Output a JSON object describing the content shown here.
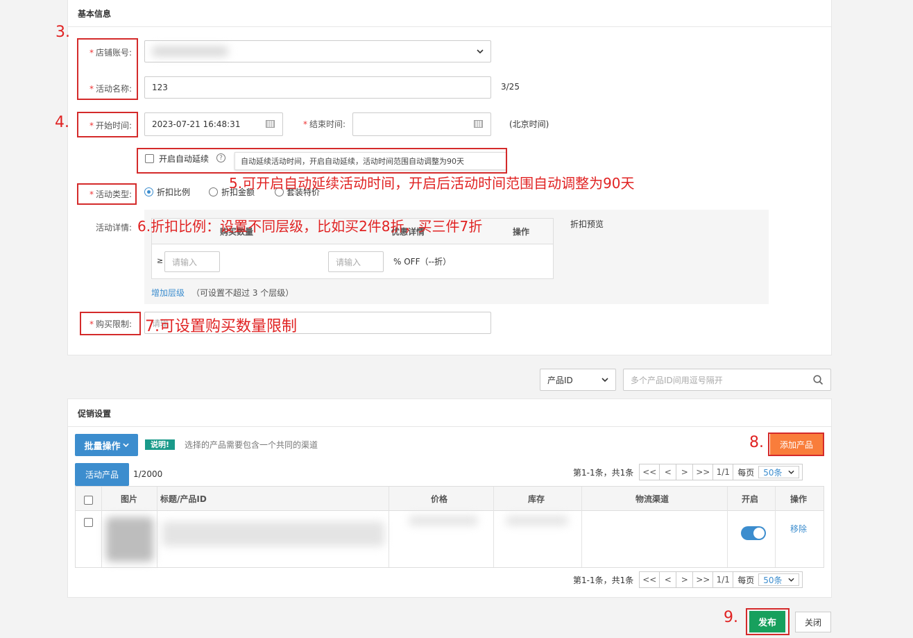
{
  "basic": {
    "title": "基本信息",
    "store_label": "店铺账号:",
    "name_label": "活动名称:",
    "name_value": "123",
    "name_count": "3/25",
    "start_label": "开始时间:",
    "start_value": "2023-07-21 16:48:31",
    "end_label": "结束时间:",
    "timezone": "(北京时间)",
    "auto_extend_label": "开启自动延续",
    "tooltip": "自动延续活动时间，开启自动延续，活动时间范围自动调整为90天",
    "type_label": "活动类型:",
    "type_options": [
      "折扣比例",
      "折扣金额",
      "套装特价"
    ],
    "detail_label": "活动详情:",
    "preview_label": "折扣预览",
    "tier_headers": [
      "购买数量",
      "优惠详情",
      "操作"
    ],
    "qty_prefix": "≥",
    "qty_placeholder": "请输入",
    "discount_placeholder": "请输入",
    "discount_suffix": "% OFF（--折）",
    "add_tier": "增加层级",
    "add_tier_note": "（可设置不超过 3 个层级）",
    "limit_label": "购买限制:",
    "limit_placeholder": "请输"
  },
  "search": {
    "select_value": "产品ID",
    "placeholder": "多个产品ID间用逗号隔开"
  },
  "promo": {
    "title": "促销设置",
    "batch_label": "批量操作",
    "note_badge": "说明!",
    "note_text": "选择的产品需要包含一个共同的渠道",
    "add_product": "添加产品",
    "tab_active": "活动产品",
    "count": "1/2000",
    "pager_text": "第1-1条，共1条",
    "pager_buttons": [
      "<<",
      "<",
      ">",
      ">>"
    ],
    "page_info": "1/1",
    "per_page_label": "每页",
    "per_page_value": "50条",
    "columns": [
      "图片",
      "标题/产品ID",
      "价格",
      "库存",
      "物流渠道",
      "开启",
      "操作"
    ],
    "row_action": "移除",
    "publish": "发布",
    "close": "关闭"
  },
  "annotations": {
    "a3": "3.",
    "a4": "4.",
    "a5": "5.可开启自动延续活动时间，开启后活动时间范围自动调整为90天",
    "a6": "6.折扣比例：设置不同层级，比如买2件8折，买三件7折",
    "a7": "7.可设置购买数量限制",
    "a8": "8.",
    "a9": "9."
  },
  "colors": {
    "primary": "#3c8dce",
    "orange": "#f97d3b",
    "green": "#17a05d",
    "annotation_red": "#e02222",
    "note_teal": "#1a9a8a"
  }
}
